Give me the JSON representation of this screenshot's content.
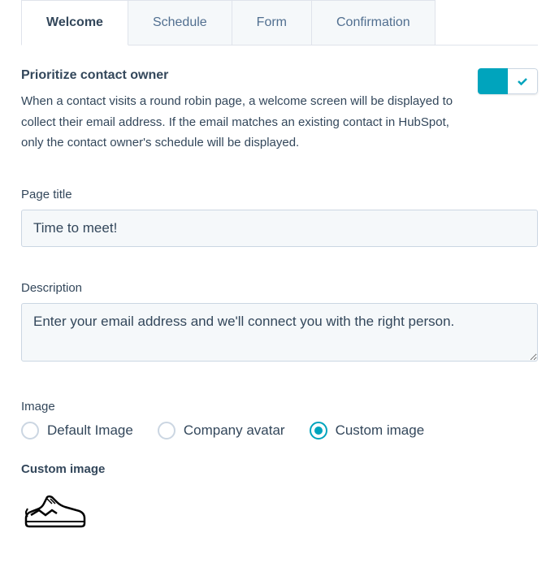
{
  "tabs": {
    "welcome": "Welcome",
    "schedule": "Schedule",
    "form": "Form",
    "confirmation": "Confirmation"
  },
  "prioritize": {
    "title": "Prioritize contact owner",
    "description": "When a contact visits a round robin page, a welcome screen will be displayed to collect their email address. If the email matches an existing contact in HubSpot, only the contact owner's schedule will be displayed."
  },
  "pageTitle": {
    "label": "Page title",
    "value": "Time to meet!"
  },
  "description": {
    "label": "Description",
    "value": "Enter your email address and we'll connect you with the right person."
  },
  "image": {
    "label": "Image",
    "options": {
      "default": "Default Image",
      "company": "Company avatar",
      "custom": "Custom image"
    }
  },
  "customImage": {
    "label": "Custom image"
  }
}
